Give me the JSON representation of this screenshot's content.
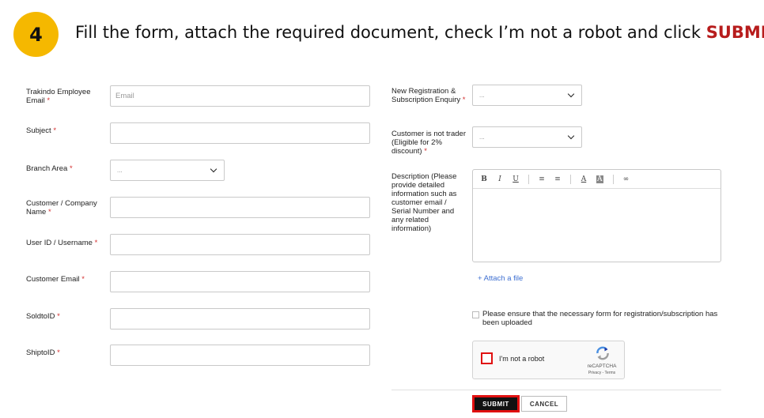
{
  "header": {
    "step_number": "4",
    "instruction_text": "Fill the form, attach the required document, check I’m not a robot and click ",
    "instruction_keyword": "SUBMIT",
    "badge_color": "#f5b800",
    "keyword_color": "#b71c1c"
  },
  "form": {
    "required_mark": "*",
    "left_fields": {
      "employee_email": {
        "label": "Trakindo Employee Email",
        "placeholder": "Email",
        "value": ""
      },
      "subject": {
        "label": "Subject",
        "value": ""
      },
      "branch_area": {
        "label": "Branch Area",
        "selected": "..."
      },
      "customer_name": {
        "label": "Customer / Company Name",
        "value": ""
      },
      "user_id": {
        "label": "User ID / Username",
        "value": ""
      },
      "customer_email": {
        "label": "Customer Email",
        "value": ""
      },
      "soldto_id": {
        "label": "SoldtoID",
        "value": ""
      },
      "shipto_id": {
        "label": "ShiptoID",
        "value": ""
      }
    },
    "right_fields": {
      "new_registration": {
        "label": "New Registration & Subscription Enquiry",
        "selected": "..."
      },
      "not_trader": {
        "label": "Customer is not trader (Eligible for 2% discount)",
        "selected": "..."
      },
      "description": {
        "label": "Description (Please provide detailed information such as customer email / Serial Number and any related information)",
        "value": ""
      }
    },
    "editor_toolbar": {
      "bold": "B",
      "italic": "I",
      "underline": "U",
      "bullet_list": "≡",
      "numbered_list": "≡",
      "font_color": "A",
      "highlight": "A",
      "link": "∞"
    },
    "attach_label": "+ Attach a file",
    "ensure_checkbox_label": "Please ensure that the necessary form for registration/subscription has been uploaded",
    "recaptcha": {
      "checkbox_label": "I'm not a robot",
      "brand": "reCAPTCHA",
      "links": "Privacy - Terms"
    },
    "buttons": {
      "submit": "SUBMIT",
      "cancel": "CANCEL"
    },
    "highlight_color": "#e01010"
  }
}
